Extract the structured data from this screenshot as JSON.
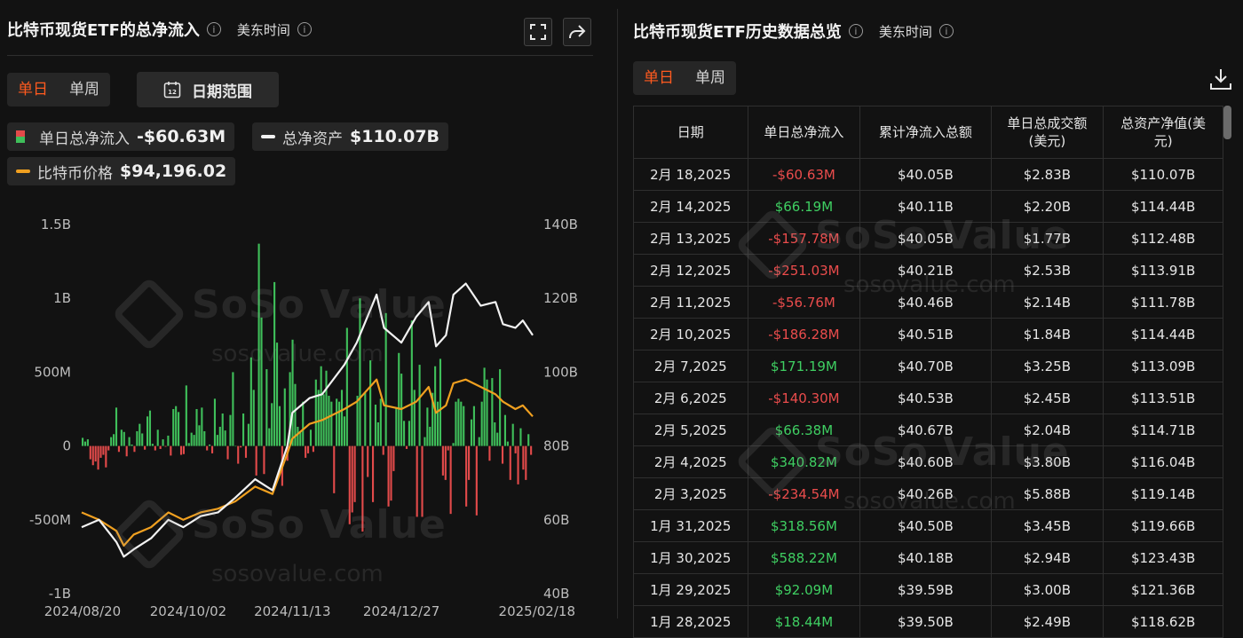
{
  "left": {
    "title": "比特币现货ETF的总净流入",
    "timezone": "美东时间",
    "tabs": [
      "单日",
      "单周"
    ],
    "date_range_label": "日期范围",
    "date_icon_text": "12",
    "legend": {
      "flow_label": "单日总净流入",
      "flow_value": "-$60.63M",
      "assets_label": "总净资产",
      "assets_value": "$110.07B",
      "price_label": "比特币价格",
      "price_value": "$94,196.02"
    },
    "watermark": {
      "brand": "SoSo Value",
      "url": "sosovalue.com"
    }
  },
  "right": {
    "title": "比特币现货ETF历史数据总览",
    "timezone": "美东时间",
    "tabs": [
      "单日",
      "单周"
    ],
    "columns": [
      "日期",
      "单日总净流入",
      "累计净流入总额",
      "单日总成交额\n(美元)",
      "总资产净值(美\n元)"
    ],
    "rows": [
      [
        "2月 18,2025",
        "-$60.63M",
        "$40.05B",
        "$2.83B",
        "$110.07B"
      ],
      [
        "2月 14,2025",
        "$66.19M",
        "$40.11B",
        "$2.20B",
        "$114.44B"
      ],
      [
        "2月 13,2025",
        "-$157.78M",
        "$40.05B",
        "$1.77B",
        "$112.48B"
      ],
      [
        "2月 12,2025",
        "-$251.03M",
        "$40.21B",
        "$2.53B",
        "$113.91B"
      ],
      [
        "2月 11,2025",
        "-$56.76M",
        "$40.46B",
        "$2.14B",
        "$111.78B"
      ],
      [
        "2月 10,2025",
        "-$186.28M",
        "$40.51B",
        "$1.84B",
        "$114.44B"
      ],
      [
        "2月 7,2025",
        "$171.19M",
        "$40.70B",
        "$3.25B",
        "$113.09B"
      ],
      [
        "2月 6,2025",
        "-$140.30M",
        "$40.53B",
        "$2.45B",
        "$113.51B"
      ],
      [
        "2月 5,2025",
        "$66.38M",
        "$40.67B",
        "$2.04B",
        "$114.71B"
      ],
      [
        "2月 4,2025",
        "$340.82M",
        "$40.60B",
        "$3.80B",
        "$116.04B"
      ],
      [
        "2月 3,2025",
        "-$234.54M",
        "$40.26B",
        "$5.88B",
        "$119.14B"
      ],
      [
        "1月 31,2025",
        "$318.56M",
        "$40.50B",
        "$3.45B",
        "$119.66B"
      ],
      [
        "1月 30,2025",
        "$588.22M",
        "$40.18B",
        "$2.94B",
        "$123.43B"
      ],
      [
        "1月 29,2025",
        "$92.09M",
        "$39.59B",
        "$3.00B",
        "$121.36B"
      ],
      [
        "1月 28,2025",
        "$18.44M",
        "$39.50B",
        "$2.49B",
        "$118.62B"
      ]
    ],
    "watermark": {
      "brand": "SoSo Value",
      "url": "sosovalue.com"
    }
  },
  "colors": {
    "positive": "#3fbf5a",
    "negative": "#e24a4a",
    "assets_line": "#f2f2f2",
    "price_line": "#f0a020",
    "accent": "#ff5a1f"
  },
  "chart_data": {
    "type": "bar",
    "title": "比特币现货ETF的总净流入",
    "x_ticks": [
      "2024/08/20",
      "2024/10/02",
      "2024/11/13",
      "2024/12/27",
      "2025/02/18"
    ],
    "x_range": [
      "2024/08/20",
      "2025/02/18"
    ],
    "y_left": {
      "ticks": [
        "-1B",
        "-500M",
        "0",
        "500M",
        "1B",
        "1.5B"
      ],
      "range": [
        -1000,
        1500
      ],
      "unit": "M"
    },
    "y_right": {
      "ticks": [
        "40B",
        "60B",
        "80B",
        "100B",
        "120B",
        "140B"
      ],
      "range": [
        40,
        140
      ],
      "unit": "B"
    },
    "series": [
      {
        "name": "单日总净流入",
        "type": "bar",
        "axis": "left",
        "values": [
          55,
          30,
          45,
          -90,
          -130,
          -105,
          -160,
          -80,
          -60,
          -145,
          -30,
          60,
          80,
          260,
          -40,
          110,
          95,
          -70,
          60,
          10,
          -40,
          100,
          150,
          85,
          -25,
          200,
          240,
          15,
          -30,
          110,
          -20,
          45,
          -5,
          70,
          -65,
          250,
          270,
          230,
          -60,
          -55,
          410,
          20,
          90,
          75,
          250,
          140,
          260,
          100,
          -30,
          10,
          -50,
          320,
          75,
          130,
          220,
          105,
          -90,
          210,
          500,
          0,
          -120,
          -10,
          220,
          -80,
          150,
          600,
          380,
          -200,
          1370,
          870,
          -190,
          520,
          120,
          290,
          1110,
          700,
          270,
          -270,
          390,
          -100,
          500,
          720,
          420,
          130,
          100,
          300,
          -80,
          -50,
          110,
          -40,
          450,
          380,
          540,
          350,
          510,
          340,
          300,
          -320,
          320,
          300,
          380,
          200,
          800,
          -530,
          -450,
          -380,
          340,
          1000,
          -580,
          360,
          -210,
          580,
          -380,
          280,
          160,
          320,
          -60,
          900,
          -410,
          -370,
          -170,
          260,
          630,
          490,
          170,
          -20,
          170,
          850,
          380,
          -480,
          550,
          -480,
          60,
          260,
          130,
          360,
          540,
          300,
          590,
          -200,
          -230,
          -30,
          -460,
          20,
          300,
          320,
          300,
          270,
          -410,
          -230,
          180,
          270,
          -470,
          60,
          300,
          530,
          450,
          -100,
          460,
          160,
          90,
          520,
          -120,
          210,
          30,
          -230,
          150,
          -50,
          -260,
          120,
          -160,
          -230,
          80,
          -60
        ]
      },
      {
        "name": "总净资产",
        "type": "line",
        "axis": "right",
        "points": [
          [
            "2024/08/20",
            58
          ],
          [
            "2024/08/27",
            60
          ],
          [
            "2024/09/03",
            54
          ],
          [
            "2024/09/06",
            50
          ],
          [
            "2024/09/10",
            52
          ],
          [
            "2024/09/17",
            55
          ],
          [
            "2024/09/24",
            60
          ],
          [
            "2024/09/30",
            58
          ],
          [
            "2024/10/07",
            61
          ],
          [
            "2024/10/14",
            62
          ],
          [
            "2024/10/21",
            66
          ],
          [
            "2024/10/29",
            71
          ],
          [
            "2024/11/05",
            68
          ],
          [
            "2024/11/11",
            80
          ],
          [
            "2024/11/13",
            89
          ],
          [
            "2024/11/20",
            93
          ],
          [
            "2024/11/25",
            94
          ],
          [
            "2024/12/04",
            102
          ],
          [
            "2024/12/09",
            108
          ],
          [
            "2024/12/17",
            121
          ],
          [
            "2024/12/20",
            112
          ],
          [
            "2024/12/27",
            108
          ],
          [
            "2025/01/02",
            115
          ],
          [
            "2025/01/07",
            119
          ],
          [
            "2025/01/10",
            107
          ],
          [
            "2025/01/14",
            110
          ],
          [
            "2025/01/17",
            121
          ],
          [
            "2025/01/22",
            124
          ],
          [
            "2025/01/28",
            118
          ],
          [
            "2025/02/03",
            119
          ],
          [
            "2025/02/06",
            113
          ],
          [
            "2025/02/11",
            112
          ],
          [
            "2025/02/14",
            114
          ],
          [
            "2025/02/18",
            110
          ]
        ]
      },
      {
        "name": "比特币价格",
        "type": "line",
        "axis": "right",
        "points": [
          [
            "2024/08/20",
            62
          ],
          [
            "2024/08/27",
            60
          ],
          [
            "2024/09/03",
            57
          ],
          [
            "2024/09/06",
            53
          ],
          [
            "2024/09/10",
            56
          ],
          [
            "2024/09/17",
            58
          ],
          [
            "2024/09/24",
            62
          ],
          [
            "2024/09/30",
            60
          ],
          [
            "2024/10/07",
            62
          ],
          [
            "2024/10/14",
            63
          ],
          [
            "2024/10/21",
            65
          ],
          [
            "2024/10/29",
            69
          ],
          [
            "2024/11/05",
            67
          ],
          [
            "2024/11/11",
            78
          ],
          [
            "2024/11/13",
            82
          ],
          [
            "2024/11/20",
            86
          ],
          [
            "2024/11/25",
            87
          ],
          [
            "2024/12/04",
            90
          ],
          [
            "2024/12/09",
            92
          ],
          [
            "2024/12/17",
            98
          ],
          [
            "2024/12/20",
            91
          ],
          [
            "2024/12/27",
            90
          ],
          [
            "2025/01/02",
            92
          ],
          [
            "2025/01/07",
            96
          ],
          [
            "2025/01/10",
            89
          ],
          [
            "2025/01/14",
            91
          ],
          [
            "2025/01/17",
            97
          ],
          [
            "2025/01/22",
            98
          ],
          [
            "2025/01/28",
            96
          ],
          [
            "2025/02/03",
            94
          ],
          [
            "2025/02/06",
            92
          ],
          [
            "2025/02/11",
            90
          ],
          [
            "2025/02/14",
            91
          ],
          [
            "2025/02/18",
            88
          ]
        ]
      }
    ],
    "grid": false,
    "legend_placement": "top-left"
  }
}
